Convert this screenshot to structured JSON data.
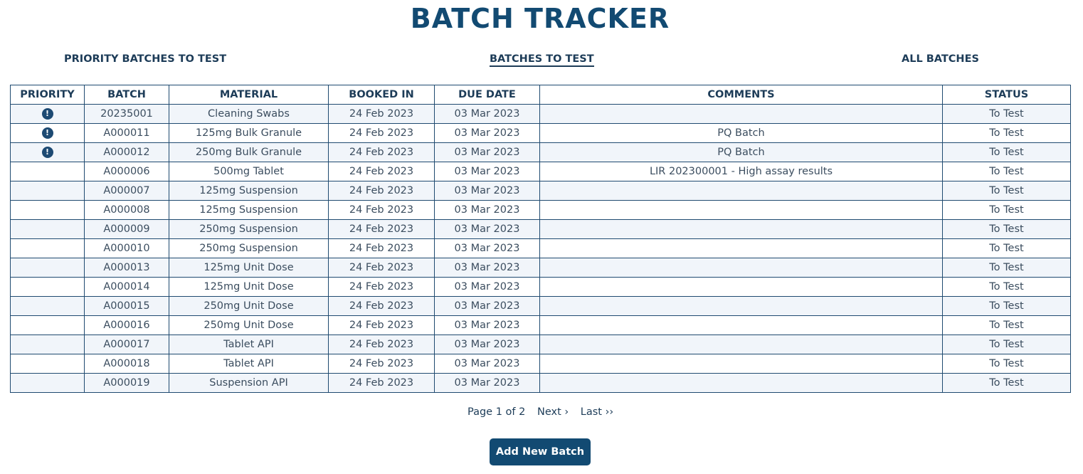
{
  "title": "BATCH TRACKER",
  "nav": {
    "priority": "PRIORITY BATCHES TO TEST",
    "batches_to_test": "BATCHES TO TEST",
    "all_batches": "ALL BATCHES",
    "active": "batches_to_test"
  },
  "table": {
    "headers": [
      "PRIORITY",
      "BATCH",
      "MATERIAL",
      "BOOKED IN",
      "DUE DATE",
      "COMMENTS",
      "STATUS"
    ],
    "rows": [
      {
        "priority": true,
        "priority_icon": "exclamation-icon",
        "batch": "20235001",
        "material": "Cleaning Swabs",
        "booked_in": "24 Feb 2023",
        "due_date": "03 Mar 2023",
        "comments": "",
        "status": "To Test"
      },
      {
        "priority": true,
        "priority_icon": "exclamation-icon",
        "batch": "A000011",
        "material": "125mg Bulk Granule",
        "booked_in": "24 Feb 2023",
        "due_date": "03 Mar 2023",
        "comments": "PQ Batch",
        "status": "To Test"
      },
      {
        "priority": true,
        "priority_icon": "exclamation-icon",
        "batch": "A000012",
        "material": "250mg Bulk Granule",
        "booked_in": "24 Feb 2023",
        "due_date": "03 Mar 2023",
        "comments": "PQ Batch",
        "status": "To Test"
      },
      {
        "priority": false,
        "batch": "A000006",
        "material": "500mg Tablet",
        "booked_in": "24 Feb 2023",
        "due_date": "03 Mar 2023",
        "comments": "LIR 202300001 - High assay results",
        "status": "To Test"
      },
      {
        "priority": false,
        "batch": "A000007",
        "material": "125mg Suspension",
        "booked_in": "24 Feb 2023",
        "due_date": "03 Mar 2023",
        "comments": "",
        "status": "To Test"
      },
      {
        "priority": false,
        "batch": "A000008",
        "material": "125mg Suspension",
        "booked_in": "24 Feb 2023",
        "due_date": "03 Mar 2023",
        "comments": "",
        "status": "To Test"
      },
      {
        "priority": false,
        "batch": "A000009",
        "material": "250mg Suspension",
        "booked_in": "24 Feb 2023",
        "due_date": "03 Mar 2023",
        "comments": "",
        "status": "To Test"
      },
      {
        "priority": false,
        "batch": "A000010",
        "material": "250mg Suspension",
        "booked_in": "24 Feb 2023",
        "due_date": "03 Mar 2023",
        "comments": "",
        "status": "To Test"
      },
      {
        "priority": false,
        "batch": "A000013",
        "material": "125mg Unit Dose",
        "booked_in": "24 Feb 2023",
        "due_date": "03 Mar 2023",
        "comments": "",
        "status": "To Test"
      },
      {
        "priority": false,
        "batch": "A000014",
        "material": "125mg Unit Dose",
        "booked_in": "24 Feb 2023",
        "due_date": "03 Mar 2023",
        "comments": "",
        "status": "To Test"
      },
      {
        "priority": false,
        "batch": "A000015",
        "material": "250mg Unit Dose",
        "booked_in": "24 Feb 2023",
        "due_date": "03 Mar 2023",
        "comments": "",
        "status": "To Test"
      },
      {
        "priority": false,
        "batch": "A000016",
        "material": "250mg Unit Dose",
        "booked_in": "24 Feb 2023",
        "due_date": "03 Mar 2023",
        "comments": "",
        "status": "To Test"
      },
      {
        "priority": false,
        "batch": "A000017",
        "material": "Tablet API",
        "booked_in": "24 Feb 2023",
        "due_date": "03 Mar 2023",
        "comments": "",
        "status": "To Test"
      },
      {
        "priority": false,
        "batch": "A000018",
        "material": "Tablet API",
        "booked_in": "24 Feb 2023",
        "due_date": "03 Mar 2023",
        "comments": "",
        "status": "To Test"
      },
      {
        "priority": false,
        "batch": "A000019",
        "material": "Suspension API",
        "booked_in": "24 Feb 2023",
        "due_date": "03 Mar 2023",
        "comments": "",
        "status": "To Test"
      }
    ]
  },
  "pagination": {
    "page_info": "Page 1 of 2",
    "next_label": "Next ›",
    "last_label": "Last ››"
  },
  "add_button_label": "Add New Batch",
  "colors": {
    "accent": "#124a72",
    "text": "#1d3c58",
    "row_alt": "#f1f5fa",
    "border": "#1f4a70"
  }
}
